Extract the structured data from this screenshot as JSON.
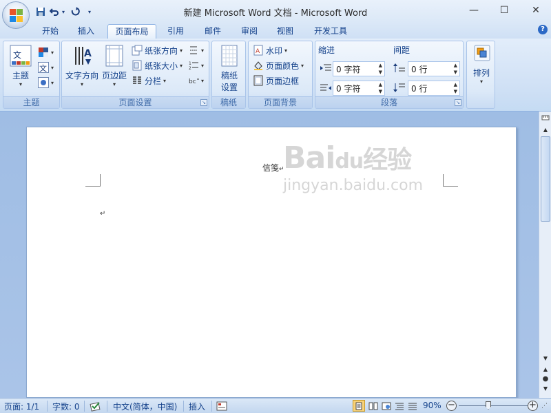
{
  "window": {
    "title": "新建 Microsoft Word 文档 - Microsoft Word",
    "minimize_glyph": "—",
    "maximize_glyph": "☐",
    "close_glyph": "✕"
  },
  "quick_access": {
    "items": [
      "save-icon",
      "undo-icon",
      "redo-icon",
      "customize-icon"
    ]
  },
  "tabs": [
    {
      "label": "开始",
      "active": false
    },
    {
      "label": "插入",
      "active": false
    },
    {
      "label": "页面布局",
      "active": true
    },
    {
      "label": "引用",
      "active": false
    },
    {
      "label": "邮件",
      "active": false
    },
    {
      "label": "审阅",
      "active": false
    },
    {
      "label": "视图",
      "active": false
    },
    {
      "label": "开发工具",
      "active": false
    }
  ],
  "help_glyph": "?",
  "ribbon": {
    "themes": {
      "label": "主题",
      "button": "主题"
    },
    "page_setup": {
      "label": "页面设置",
      "text_direction": "文字方向",
      "margins": "页边距",
      "orientation": "纸张方向",
      "size": "纸张大小",
      "columns": "分栏"
    },
    "manuscript": {
      "label": "稿纸",
      "button_line1": "稿纸",
      "button_line2": "设置"
    },
    "page_background": {
      "label": "页面背景",
      "watermark": "水印",
      "page_color": "页面颜色",
      "page_borders": "页面边框"
    },
    "paragraph": {
      "label": "段落",
      "indent_label": "缩进",
      "spacing_label": "间距",
      "indent_left": "0 字符",
      "indent_right": "0 字符",
      "spacing_before": "0 行",
      "spacing_after": "0 行"
    },
    "arrange": {
      "label": "排列"
    }
  },
  "document": {
    "header_text": "信笺",
    "paragraph_mark": "↵"
  },
  "watermark": {
    "brand": "Bai",
    "brand2": "du",
    "brand_cn": "经验",
    "url": "jingyan.baidu.com"
  },
  "statusbar": {
    "page": "页面: 1/1",
    "words": "字数: 0",
    "language": "中文(简体，中国)",
    "mode": "插入",
    "zoom": "90%"
  }
}
